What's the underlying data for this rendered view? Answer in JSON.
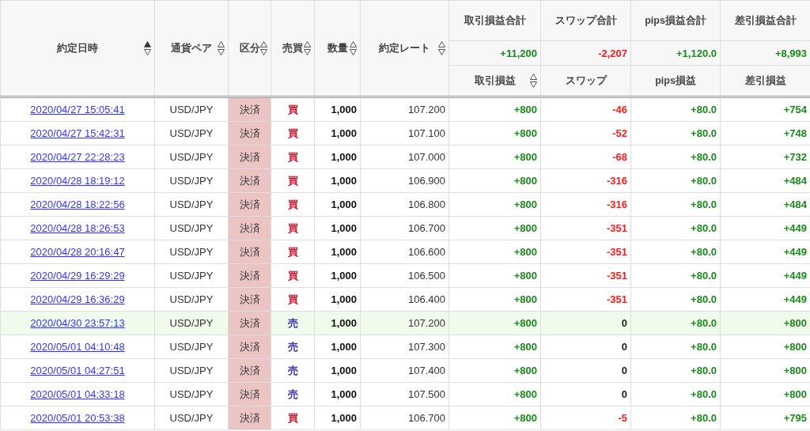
{
  "table": {
    "columns": [
      {
        "label": "約定日時",
        "sorted": true
      },
      {
        "label": "通貨ペア",
        "sorted": false
      },
      {
        "label": "区分",
        "sorted": false
      },
      {
        "label": "売買",
        "sorted": false
      },
      {
        "label": "数量",
        "sorted": false
      },
      {
        "label": "約定レート",
        "sorted": false
      }
    ],
    "summary_columns": [
      {
        "title": "取引損益合計",
        "total": "+11,200",
        "gain": true,
        "loss": false,
        "label": "取引損益",
        "sorted": false
      },
      {
        "title": "スワップ合計",
        "total": "-2,207",
        "gain": false,
        "loss": true,
        "label": "スワップ"
      },
      {
        "title": "pips損益合計",
        "total": "+1,120.0",
        "gain": true,
        "loss": false,
        "label": "pips損益"
      },
      {
        "title": "差引損益合計",
        "total": "+8,993",
        "gain": true,
        "loss": false,
        "label": "差引損益"
      }
    ],
    "rows": [
      {
        "time": "2020/04/27 15:05:41",
        "pair": "USD/JPY",
        "type": "決済",
        "side": "買",
        "sell": false,
        "qty": "1,000",
        "rate": "107.200",
        "values": [
          {
            "text": "+800",
            "gain": true,
            "loss": false
          },
          {
            "text": "-46",
            "gain": false,
            "loss": true
          },
          {
            "text": "+80.0",
            "gain": true,
            "loss": false
          },
          {
            "text": "+754",
            "gain": true,
            "loss": false
          }
        ],
        "highlighted": false
      },
      {
        "time": "2020/04/27 15:42:31",
        "pair": "USD/JPY",
        "type": "決済",
        "side": "買",
        "sell": false,
        "qty": "1,000",
        "rate": "107.100",
        "values": [
          {
            "text": "+800",
            "gain": true,
            "loss": false
          },
          {
            "text": "-52",
            "gain": false,
            "loss": true
          },
          {
            "text": "+80.0",
            "gain": true,
            "loss": false
          },
          {
            "text": "+748",
            "gain": true,
            "loss": false
          }
        ],
        "highlighted": false
      },
      {
        "time": "2020/04/27 22:28:23",
        "pair": "USD/JPY",
        "type": "決済",
        "side": "買",
        "sell": false,
        "qty": "1,000",
        "rate": "107.000",
        "values": [
          {
            "text": "+800",
            "gain": true,
            "loss": false
          },
          {
            "text": "-68",
            "gain": false,
            "loss": true
          },
          {
            "text": "+80.0",
            "gain": true,
            "loss": false
          },
          {
            "text": "+732",
            "gain": true,
            "loss": false
          }
        ],
        "highlighted": false
      },
      {
        "time": "2020/04/28 18:19:12",
        "pair": "USD/JPY",
        "type": "決済",
        "side": "買",
        "sell": false,
        "qty": "1,000",
        "rate": "106.900",
        "values": [
          {
            "text": "+800",
            "gain": true,
            "loss": false
          },
          {
            "text": "-316",
            "gain": false,
            "loss": true
          },
          {
            "text": "+80.0",
            "gain": true,
            "loss": false
          },
          {
            "text": "+484",
            "gain": true,
            "loss": false
          }
        ],
        "highlighted": false
      },
      {
        "time": "2020/04/28 18:22:56",
        "pair": "USD/JPY",
        "type": "決済",
        "side": "買",
        "sell": false,
        "qty": "1,000",
        "rate": "106.800",
        "values": [
          {
            "text": "+800",
            "gain": true,
            "loss": false
          },
          {
            "text": "-316",
            "gain": false,
            "loss": true
          },
          {
            "text": "+80.0",
            "gain": true,
            "loss": false
          },
          {
            "text": "+484",
            "gain": true,
            "loss": false
          }
        ],
        "highlighted": false
      },
      {
        "time": "2020/04/28 18:26:53",
        "pair": "USD/JPY",
        "type": "決済",
        "side": "買",
        "sell": false,
        "qty": "1,000",
        "rate": "106.700",
        "values": [
          {
            "text": "+800",
            "gain": true,
            "loss": false
          },
          {
            "text": "-351",
            "gain": false,
            "loss": true
          },
          {
            "text": "+80.0",
            "gain": true,
            "loss": false
          },
          {
            "text": "+449",
            "gain": true,
            "loss": false
          }
        ],
        "highlighted": false
      },
      {
        "time": "2020/04/28 20:16:47",
        "pair": "USD/JPY",
        "type": "決済",
        "side": "買",
        "sell": false,
        "qty": "1,000",
        "rate": "106.600",
        "values": [
          {
            "text": "+800",
            "gain": true,
            "loss": false
          },
          {
            "text": "-351",
            "gain": false,
            "loss": true
          },
          {
            "text": "+80.0",
            "gain": true,
            "loss": false
          },
          {
            "text": "+449",
            "gain": true,
            "loss": false
          }
        ],
        "highlighted": false
      },
      {
        "time": "2020/04/29 16:29:29",
        "pair": "USD/JPY",
        "type": "決済",
        "side": "買",
        "sell": false,
        "qty": "1,000",
        "rate": "106.500",
        "values": [
          {
            "text": "+800",
            "gain": true,
            "loss": false
          },
          {
            "text": "-351",
            "gain": false,
            "loss": true
          },
          {
            "text": "+80.0",
            "gain": true,
            "loss": false
          },
          {
            "text": "+449",
            "gain": true,
            "loss": false
          }
        ],
        "highlighted": false
      },
      {
        "time": "2020/04/29 16:36:29",
        "pair": "USD/JPY",
        "type": "決済",
        "side": "買",
        "sell": false,
        "qty": "1,000",
        "rate": "106.400",
        "values": [
          {
            "text": "+800",
            "gain": true,
            "loss": false
          },
          {
            "text": "-351",
            "gain": false,
            "loss": true
          },
          {
            "text": "+80.0",
            "gain": true,
            "loss": false
          },
          {
            "text": "+449",
            "gain": true,
            "loss": false
          }
        ],
        "highlighted": false
      },
      {
        "time": "2020/04/30 23:57:13",
        "pair": "USD/JPY",
        "type": "決済",
        "side": "売",
        "sell": true,
        "qty": "1,000",
        "rate": "107.200",
        "values": [
          {
            "text": "+800",
            "gain": true,
            "loss": false
          },
          {
            "text": "0",
            "gain": false,
            "loss": false
          },
          {
            "text": "+80.0",
            "gain": true,
            "loss": false
          },
          {
            "text": "+800",
            "gain": true,
            "loss": false
          }
        ],
        "highlighted": true
      },
      {
        "time": "2020/05/01 04:10:48",
        "pair": "USD/JPY",
        "type": "決済",
        "side": "売",
        "sell": true,
        "qty": "1,000",
        "rate": "107.300",
        "values": [
          {
            "text": "+800",
            "gain": true,
            "loss": false
          },
          {
            "text": "0",
            "gain": false,
            "loss": false
          },
          {
            "text": "+80.0",
            "gain": true,
            "loss": false
          },
          {
            "text": "+800",
            "gain": true,
            "loss": false
          }
        ],
        "highlighted": false
      },
      {
        "time": "2020/05/01 04:27:51",
        "pair": "USD/JPY",
        "type": "決済",
        "side": "売",
        "sell": true,
        "qty": "1,000",
        "rate": "107.400",
        "values": [
          {
            "text": "+800",
            "gain": true,
            "loss": false
          },
          {
            "text": "0",
            "gain": false,
            "loss": false
          },
          {
            "text": "+80.0",
            "gain": true,
            "loss": false
          },
          {
            "text": "+800",
            "gain": true,
            "loss": false
          }
        ],
        "highlighted": false
      },
      {
        "time": "2020/05/01 04:33:18",
        "pair": "USD/JPY",
        "type": "決済",
        "side": "売",
        "sell": true,
        "qty": "1,000",
        "rate": "107.500",
        "values": [
          {
            "text": "+800",
            "gain": true,
            "loss": false
          },
          {
            "text": "0",
            "gain": false,
            "loss": false
          },
          {
            "text": "+80.0",
            "gain": true,
            "loss": false
          },
          {
            "text": "+800",
            "gain": true,
            "loss": false
          }
        ],
        "highlighted": false
      },
      {
        "time": "2020/05/01 20:53:38",
        "pair": "USD/JPY",
        "type": "決済",
        "side": "買",
        "sell": false,
        "qty": "1,000",
        "rate": "106.700",
        "values": [
          {
            "text": "+800",
            "gain": true,
            "loss": false
          },
          {
            "text": "-5",
            "gain": false,
            "loss": true
          },
          {
            "text": "+80.0",
            "gain": true,
            "loss": false
          },
          {
            "text": "+795",
            "gain": true,
            "loss": false
          }
        ],
        "highlighted": false
      }
    ]
  }
}
